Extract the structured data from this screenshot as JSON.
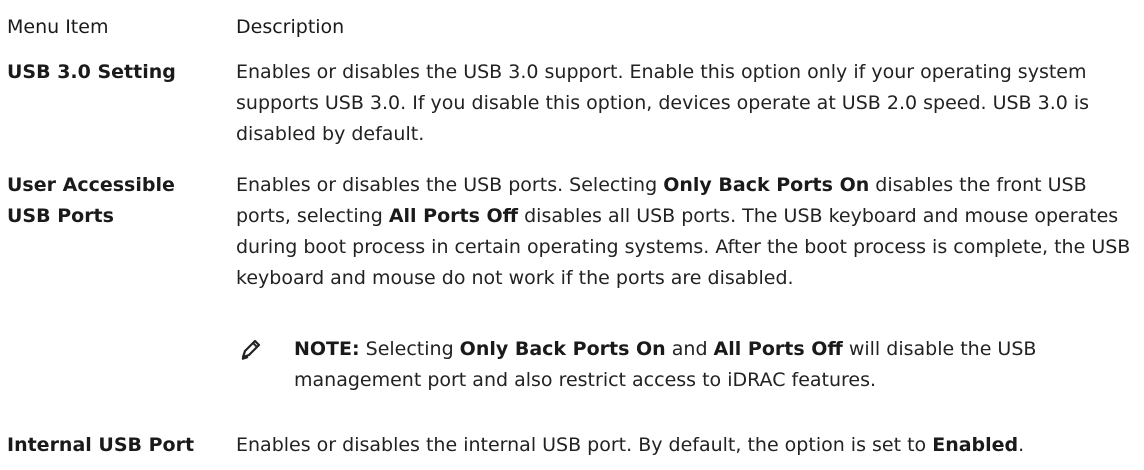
{
  "header": {
    "menu_item": "Menu Item",
    "description": "Description"
  },
  "rows": [
    {
      "menu": "USB 3.0 Setting",
      "desc_parts": [
        "Enables or disables the USB 3.0 support. Enable this option only if your operating system supports USB 3.0. If you disable this option, devices operate at USB 2.0 speed. USB 3.0 is disabled by default."
      ]
    },
    {
      "menu_line1": "User Accessible",
      "menu_line2": "USB Ports",
      "desc_parts": [
        "Enables or disables the USB ports. Selecting ",
        "Only Back Ports On",
        " disables the front USB ports, selecting ",
        "All Ports Off",
        " disables all USB ports. The USB keyboard and mouse operates during boot process in certain operating systems. After the boot process is complete, the USB keyboard and mouse do not work if the ports are disabled."
      ],
      "note": {
        "icon": "note-pencil-icon",
        "label": "NOTE:",
        "parts": [
          " Selecting ",
          "Only Back Ports On",
          " and ",
          "All Ports Off",
          " will disable the USB management port and also restrict access to iDRAC features."
        ]
      }
    },
    {
      "menu": "Internal USB Port",
      "desc_parts": [
        "Enables or disables the internal USB port. By default, the option is set to ",
        "Enabled",
        "."
      ]
    }
  ]
}
